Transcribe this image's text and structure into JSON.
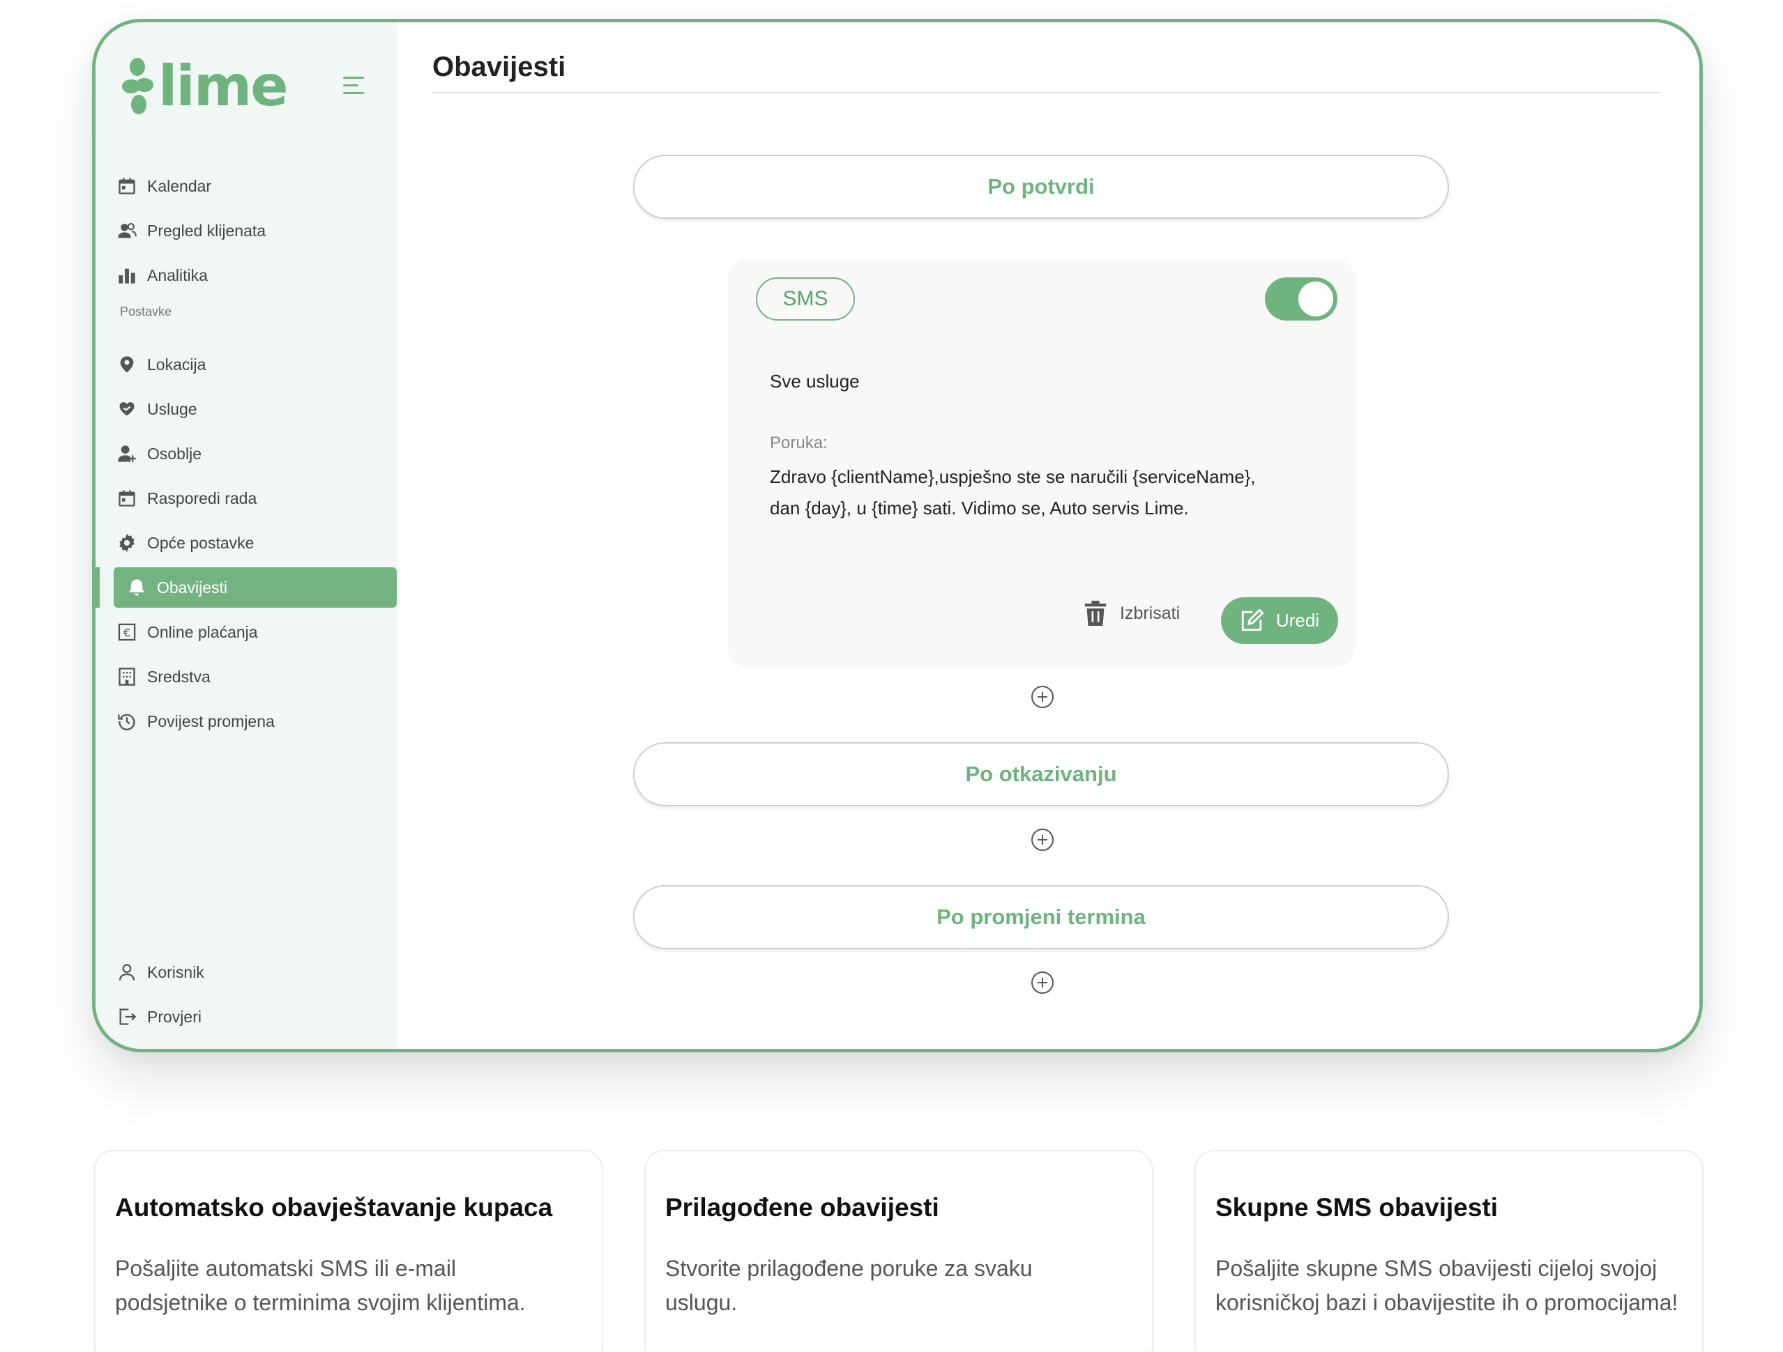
{
  "app": {
    "logo_text": "lime",
    "brand_color": "#72b381"
  },
  "sidebar": {
    "items": [
      {
        "label": "Kalendar",
        "icon": "calendar-icon"
      },
      {
        "label": "Pregled klijenata",
        "icon": "users-icon"
      },
      {
        "label": "Analitika",
        "icon": "bar-chart-icon"
      }
    ],
    "section_label": "Postavke",
    "settings_items": [
      {
        "label": "Lokacija",
        "icon": "location-pin-icon"
      },
      {
        "label": "Usluge",
        "icon": "heart-hand-icon"
      },
      {
        "label": "Osoblje",
        "icon": "user-add-icon"
      },
      {
        "label": "Rasporedi rada",
        "icon": "calendar-schedule-icon"
      },
      {
        "label": "Opće postavke",
        "icon": "gear-icon"
      },
      {
        "label": "Obavijesti",
        "icon": "bell-icon",
        "active": true
      },
      {
        "label": "Online plaćanja",
        "icon": "euro-icon"
      },
      {
        "label": "Sredstva",
        "icon": "building-icon"
      },
      {
        "label": "Povijest promjena",
        "icon": "history-icon"
      }
    ],
    "footer_items": [
      {
        "label": "Korisnik",
        "icon": "user-icon"
      },
      {
        "label": "Provjeri",
        "icon": "logout-icon"
      }
    ]
  },
  "main": {
    "title": "Obavijesti",
    "triggers": [
      {
        "label": "Po potvrdi"
      },
      {
        "label": "Po otkazivanju"
      },
      {
        "label": "Po promjeni termina"
      }
    ],
    "card": {
      "channel": "SMS",
      "enabled": true,
      "services": "Sve usluge",
      "message_label": "Poruka:",
      "message_line1": "Zdravo {clientName},uspješno ste se naručili {serviceName},",
      "message_line2": "dan {day}, u {time} sati. Vidimo se, Auto servis Lime.",
      "delete_label": "Izbrisati",
      "edit_label": "Uredi"
    }
  },
  "features": [
    {
      "title": "Automatsko obavještavanje kupaca",
      "line1": "Pošaljite automatski SMS ili e-mail",
      "line2": "podsjetnike o terminima svojim klijentima."
    },
    {
      "title": "Prilagođene obavijesti",
      "line1": "Stvorite prilagođene poruke za svaku",
      "line2": "uslugu."
    },
    {
      "title": "Skupne SMS obavijesti",
      "line1": "Pošaljite skupne SMS obavijesti cijeloj svojoj",
      "line2": "korisničkoj bazi i obavijestite ih o promocijama!"
    }
  ]
}
